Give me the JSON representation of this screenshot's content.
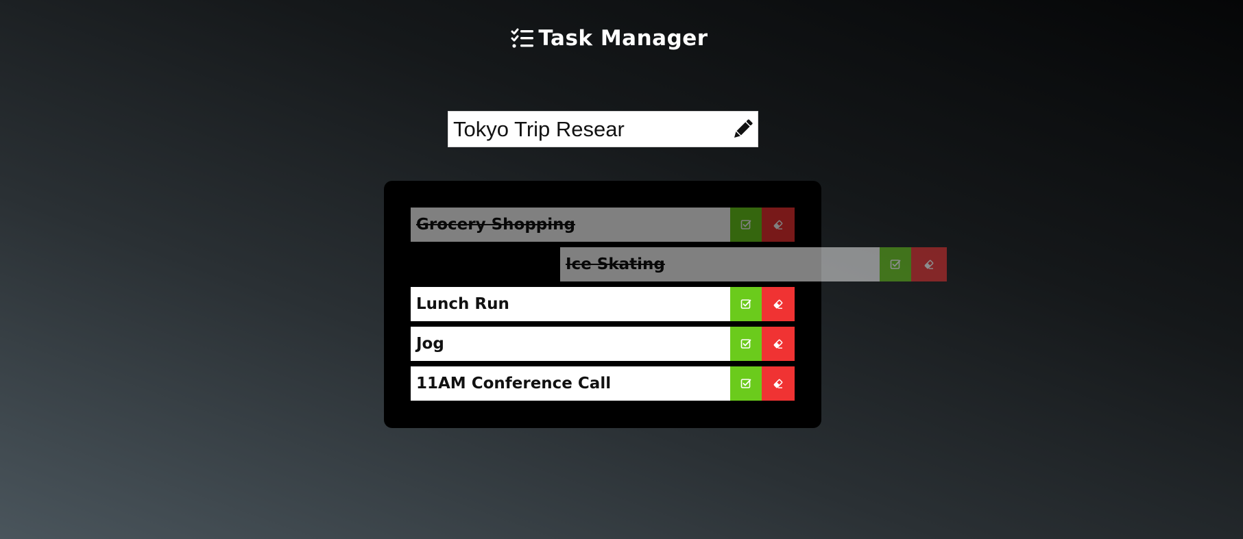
{
  "header": {
    "title": "Task Manager",
    "icon": "list-check-icon"
  },
  "input": {
    "value": "Tokyo Trip Resear",
    "submit_icon": "pencil-icon"
  },
  "todos": [
    {
      "text": "Grocery Shopping",
      "completed": true
    },
    {
      "text": "Ice Skating",
      "completed": true,
      "state": "sliding-out"
    },
    {
      "text": "Lunch Run",
      "completed": false
    },
    {
      "text": "Jog",
      "completed": false
    },
    {
      "text": "11AM Conference Call",
      "completed": false
    }
  ],
  "icons": {
    "complete": "check-square-icon",
    "delete": "eraser-icon"
  },
  "colors": {
    "complete_button": "#6bcb1c",
    "delete_button": "#f03333",
    "container": "#000000",
    "item_background": "#ffffff"
  }
}
